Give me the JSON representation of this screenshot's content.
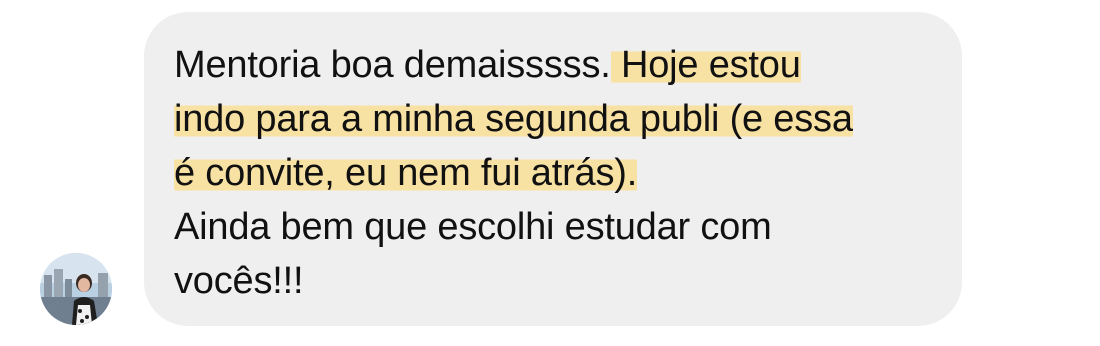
{
  "message": {
    "sender_avatar": "profile-photo",
    "highlight_color": "#f8e2a3",
    "bubble_color": "#efefef",
    "lines": {
      "l1_plain": "Mentoria boa demaisssss.",
      "l1_hl": " Hoje estou",
      "l2_hl": "indo para a minha segunda publi (e essa",
      "l3_hl": "é convite, eu nem fui atrás).",
      "l4": "Ainda bem que escolhi estudar com",
      "l5": "vocês!!!"
    }
  }
}
